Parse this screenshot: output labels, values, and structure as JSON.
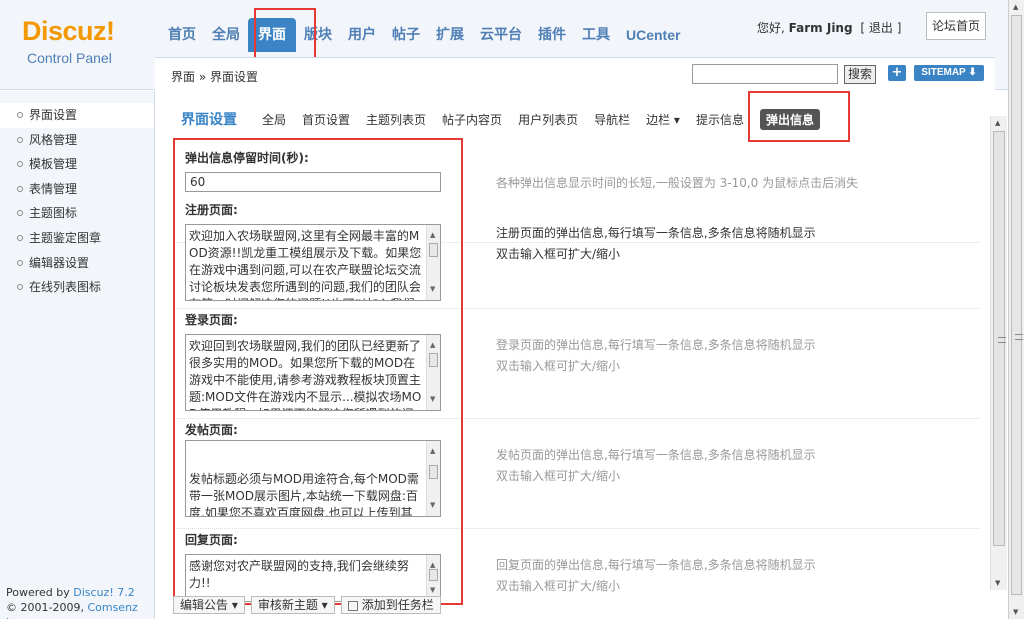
{
  "logo": {
    "brand": "Discuz!",
    "sub": "Control Panel"
  },
  "topnav": [
    {
      "label": "首页"
    },
    {
      "label": "全局"
    },
    {
      "label": "界面",
      "active": true
    },
    {
      "label": "版块"
    },
    {
      "label": "用户"
    },
    {
      "label": "帖子"
    },
    {
      "label": "扩展"
    },
    {
      "label": "云平台"
    },
    {
      "label": "插件"
    },
    {
      "label": "工具"
    },
    {
      "label": "UCenter"
    }
  ],
  "user": {
    "greeting": "您好,",
    "name": "Farm Jing",
    "logout": "[ 退出 ]",
    "forum_home": "论坛首页"
  },
  "breadcrumb": "界面 » 界面设置",
  "search": {
    "button": "搜索",
    "plus": "+",
    "sitemap": "SITEMAP ⬇"
  },
  "sidebar": {
    "items": [
      {
        "label": "界面设置",
        "active": true
      },
      {
        "label": "风格管理"
      },
      {
        "label": "模板管理"
      },
      {
        "label": "表情管理"
      },
      {
        "label": "主题图标"
      },
      {
        "label": "主题鉴定图章"
      },
      {
        "label": "编辑器设置"
      },
      {
        "label": "在线列表图标"
      }
    ],
    "powered": "Powered by",
    "powered_brand": "Discuz! 7.2",
    "copyright": "© 2001-2009,",
    "copyright_brand": "Comsenz Inc."
  },
  "tabs": {
    "title": "界面设置",
    "items": [
      "全局",
      "首页设置",
      "主题列表页",
      "帖子内容页",
      "用户列表页",
      "导航栏",
      "边栏 ▾",
      "提示信息"
    ],
    "active": "弹出信息"
  },
  "form": {
    "duration": {
      "label": "弹出信息停留时间(秒):",
      "value": "60",
      "desc": "各种弹出信息显示时间的长短,一般设置为 3-10,0 为鼠标点击后消失"
    },
    "register": {
      "label": "注册页面:",
      "value": "欢迎加入农场联盟网,这里有全网最丰富的MOD资源!!凯龙重工模组展示及下载。如果您在游戏中遇到问题,可以在农产联盟论坛交流讨论板块发表您所遇到的问题,我们的团队会在第一时间解决您的问题!!也可以加入我们的Q群……",
      "desc1": "注册页面的弹出信息,每行填写一条信息,多条信息将随机显示",
      "desc2": "双击输入框可扩大/缩小"
    },
    "login": {
      "label": "登录页面:",
      "value": "欢迎回到农场联盟网,我们的团队已经更新了很多实用的MOD。如果您所下载的MOD在游戏中不能使用,请参考游戏教程板块顶置主题:MOD文件在游戏内不显示...模拟农场MOD使用教程...如果还不能解决您所遇到的问题可加入Q群……",
      "desc1": "登录页面的弹出信息,每行填写一条信息,多条信息将随机显示",
      "desc2": "双击输入框可扩大/缩小"
    },
    "post": {
      "label": "发帖页面:",
      "value": "发帖标题必须与MOD用途符合,每个MOD需带一张MOD展示图片,本站统一下载网盘:百度,如果您不喜欢百度网盘,也可以上传到其他网盘!\n\n农场联盟发帖须知:农场联盟网不收录外网",
      "desc1": "发帖页面的弹出信息,每行填写一条信息,多条信息将随机显示",
      "desc2": "双击输入框可扩大/缩小"
    },
    "reply": {
      "label": "回复页面:",
      "value": "感谢您对农产联盟网的支持,我们会继续努力!!",
      "desc1": "回复页面的弹出信息,每行填写一条信息,多条信息将随机显示",
      "desc2": "双击输入框可扩大/缩小"
    }
  },
  "bottombar": {
    "item1": "编辑公告 ▾",
    "item2": "审核新主题 ▾",
    "item3": "添加到任务栏"
  },
  "colors": {
    "accent": "#3a84c6",
    "logo": "#f39800",
    "highlight": "#e53935"
  }
}
